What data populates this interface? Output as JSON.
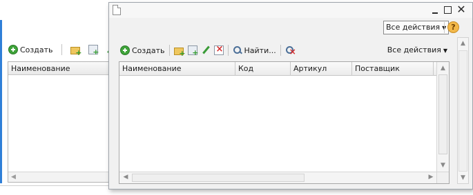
{
  "background_window": {
    "toolbar": {
      "create_label": "Создать"
    },
    "table": {
      "column_name": "Наименование"
    }
  },
  "window": {
    "header": {
      "all_actions_label": "Все действия",
      "help_icon": "?"
    },
    "toolbar": {
      "create_label": "Создать",
      "find_label": "Найти...",
      "all_actions_label": "Все действия"
    },
    "table": {
      "columns": [
        "Наименование",
        "Код",
        "Артикул",
        "Поставщик"
      ]
    }
  },
  "icons": {
    "title": "document-icon",
    "create": "plus-icon",
    "create_group": "folder-add-icon",
    "copy": "copy-icon",
    "edit": "edit-icon",
    "delete": "delete-icon",
    "find": "search-icon",
    "clear_search": "clear-search-icon"
  },
  "colors": {
    "accent": "#2f7fd8",
    "create_icon": "#3fa33a",
    "help_icon": "#f2b84a",
    "delete_icon": "#d42a2a"
  }
}
